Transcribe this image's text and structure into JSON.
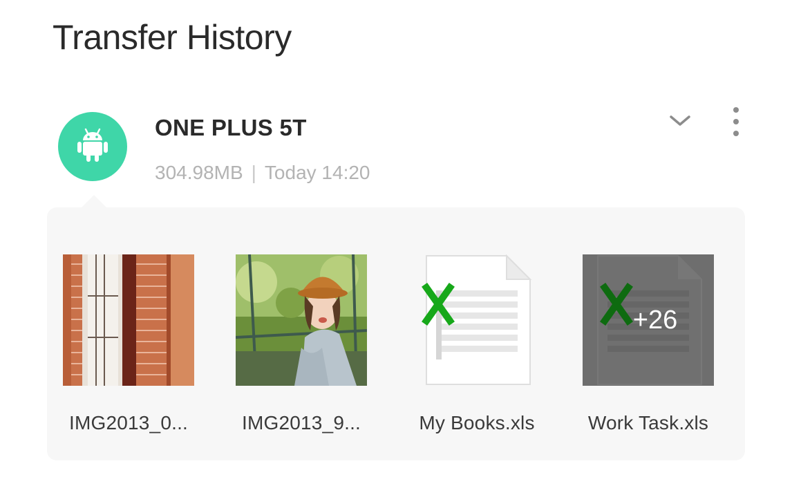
{
  "page": {
    "title": "Transfer History"
  },
  "device": {
    "name": "ONE PLUS 5T",
    "size": "304.98MB",
    "separator": "|",
    "time": "Today 14:20",
    "avatar_icon": "android-icon",
    "avatar_color": "#3fd6a8",
    "expand_icon": "chevron-down-icon",
    "menu_icon": "more-vertical-icon"
  },
  "files": [
    {
      "name": "IMG2013_0...",
      "type": "image",
      "thumb_icon": "photo-brick-window"
    },
    {
      "name": "IMG2013_9...",
      "type": "image",
      "thumb_icon": "photo-girl-hat"
    },
    {
      "name": "My Books.xls",
      "type": "spreadsheet",
      "thumb_icon": "excel-file-icon"
    },
    {
      "name": "Work Task.xls",
      "type": "spreadsheet",
      "thumb_icon": "excel-file-icon",
      "more_count": "+26"
    }
  ],
  "colors": {
    "accent": "#3fd6a8",
    "excel_green": "#17a81a",
    "panel_bg": "#f7f7f7",
    "meta_text": "#b3b3b3"
  }
}
